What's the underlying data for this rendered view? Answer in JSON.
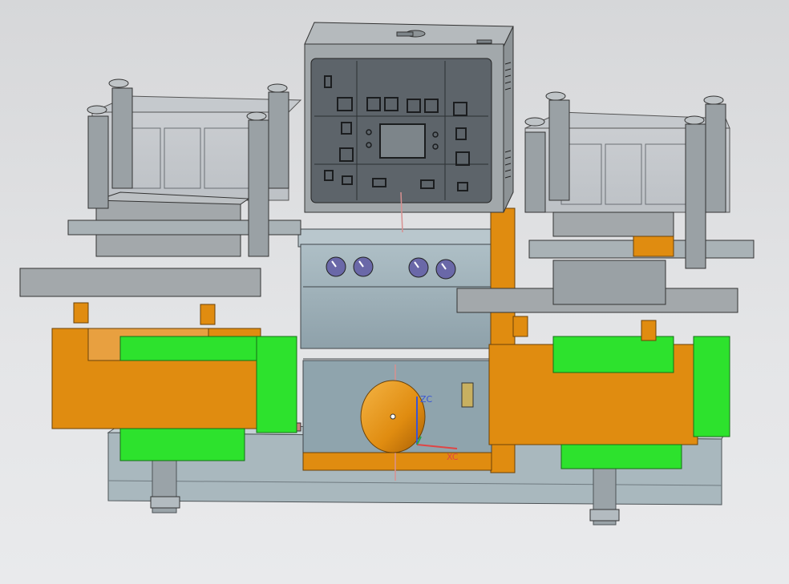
{
  "viewport": {
    "background_top": "#d6d7d9",
    "background_bottom": "#e9eaec"
  },
  "colors": {
    "orange": "#e08c10",
    "green": "#2de22d",
    "steel_blue_grey": "#9fb2ba",
    "dark_panel": "#5d646a",
    "frame_grey": "#a7acaf",
    "gauge_purple": "#6a68a8",
    "axis_blue": "#3b55d4",
    "axis_red": "#e04545",
    "axis_green": "#2ba24a"
  },
  "axes": {
    "zc_label": "ZC",
    "xc_label": "XC"
  },
  "parts": {
    "control_cabinet": "control-cabinet",
    "left_press": "left-press-station",
    "right_press": "right-press-station",
    "base": "machine-base",
    "center_column": "center-column",
    "gauges": [
      "pressure-gauge-1",
      "pressure-gauge-2",
      "pressure-gauge-3",
      "pressure-gauge-4"
    ]
  }
}
